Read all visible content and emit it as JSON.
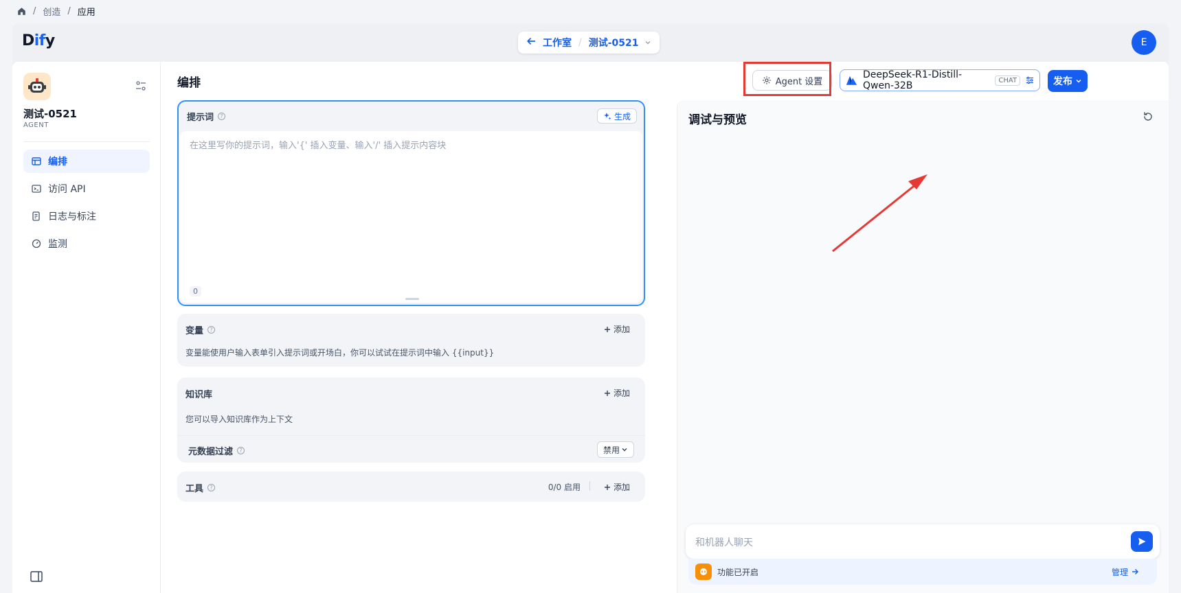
{
  "breadcrumb": {
    "sep": "/",
    "create": "创造",
    "app": "应用"
  },
  "header": {
    "logo_prefix": "D",
    "logo_mid": "if",
    "logo_suffix": "y",
    "back_label": "工作室",
    "sep": "/",
    "app_selector": "测试-0521",
    "user_initial": "E"
  },
  "sidebar": {
    "app_name": "测试-0521",
    "app_type": "AGENT",
    "items": [
      {
        "label": "编排",
        "icon": "layout-icon",
        "active": true
      },
      {
        "label": "访问 API",
        "icon": "terminal-icon",
        "active": false
      },
      {
        "label": "日志与标注",
        "icon": "log-icon",
        "active": false
      },
      {
        "label": "监测",
        "icon": "gauge-icon",
        "active": false
      }
    ]
  },
  "main": {
    "title": "编排",
    "agent_settings": "Agent 设置",
    "model_name": "DeepSeek-R1-Distill-Qwen-32B",
    "model_badge": "CHAT",
    "publish": "发布"
  },
  "prompt": {
    "title": "提示词",
    "generate": "生成",
    "placeholder": "在这里写你的提示词，输入'{' 插入变量、输入'/' 插入提示内容块",
    "count": "0"
  },
  "variables": {
    "title": "变量",
    "add": "添加",
    "desc": "变量能使用户输入表单引入提示词或开场白，你可以试试在提示词中输入 {{input}}"
  },
  "knowledge": {
    "title": "知识库",
    "add": "添加",
    "desc": "您可以导入知识库作为上下文",
    "metadata_title": "元数据过滤",
    "metadata_value": "禁用"
  },
  "tools": {
    "title": "工具",
    "status": "0/0 启用",
    "add": "添加"
  },
  "debug": {
    "title": "调试与预览",
    "chat_placeholder": "和机器人聊天",
    "features_text": "功能已开启",
    "manage": "管理"
  },
  "colors": {
    "accent": "#155eef",
    "highlight": "#e53935"
  }
}
